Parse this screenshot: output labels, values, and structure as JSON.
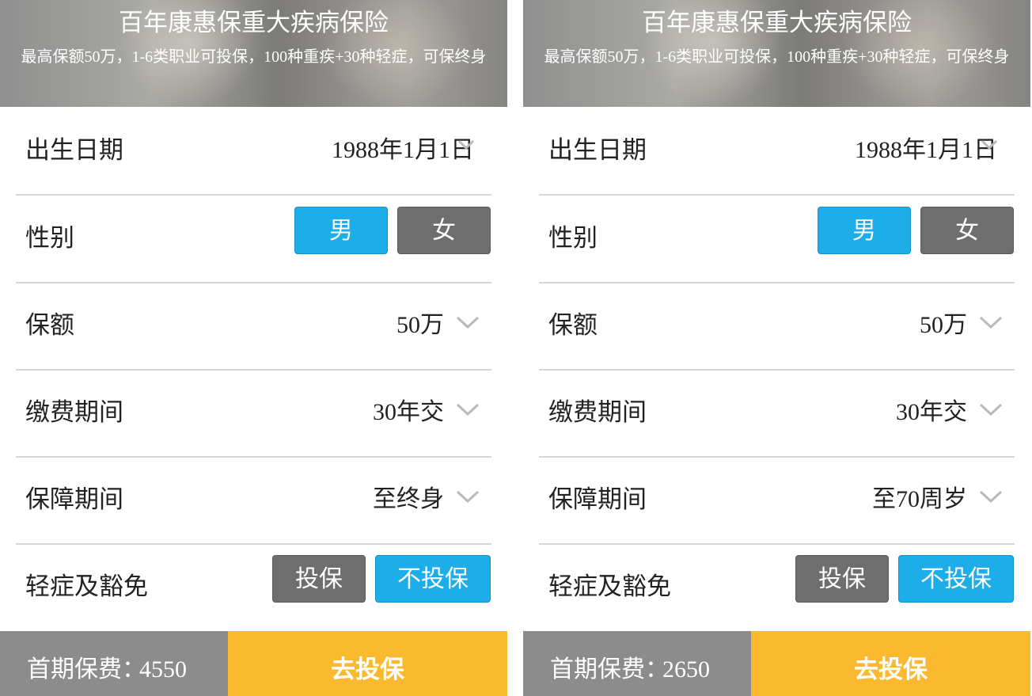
{
  "panels": [
    {
      "header": {
        "title": "百年康惠保重大疾病保险",
        "subtitle": "最高保额50万，1-6类职业可投保，100种重疾+30种轻症，可保终身"
      },
      "birth_date": {
        "label": "出生日期",
        "value": "1988年1月1日"
      },
      "gender": {
        "label": "性别",
        "male": "男",
        "female": "女",
        "selected": "男"
      },
      "coverage": {
        "label": "保额",
        "value": "50万"
      },
      "payment_period": {
        "label": "缴费期间",
        "value": "30年交"
      },
      "protection_period": {
        "label": "保障期间",
        "value": "至终身"
      },
      "mild_waiver": {
        "label": "轻症及豁免",
        "insure": "投保",
        "not_insure": "不投保",
        "selected": "不投保"
      },
      "footer": {
        "premium_label": "首期保费：",
        "premium_value": "4550",
        "cta": "去投保"
      }
    },
    {
      "header": {
        "title": "百年康惠保重大疾病保险",
        "subtitle": "最高保额50万，1-6类职业可投保，100种重疾+30种轻症，可保终身"
      },
      "birth_date": {
        "label": "出生日期",
        "value": "1988年1月1日"
      },
      "gender": {
        "label": "性别",
        "male": "男",
        "female": "女",
        "selected": "男"
      },
      "coverage": {
        "label": "保额",
        "value": "50万"
      },
      "payment_period": {
        "label": "缴费期间",
        "value": "30年交"
      },
      "protection_period": {
        "label": "保障期间",
        "value": "至70周岁"
      },
      "mild_waiver": {
        "label": "轻症及豁免",
        "insure": "投保",
        "not_insure": "不投保",
        "selected": "不投保"
      },
      "footer": {
        "premium_label": "首期保费：",
        "premium_value": "2650",
        "cta": "去投保"
      }
    }
  ],
  "colors": {
    "selected_button": "#1daee9",
    "unselected_button": "#6e6e6e",
    "cta": "#fbb930",
    "premium_bar": "#8c8c8c",
    "divider": "#d6d6d6"
  },
  "icons": {
    "dropdown": "chevron-down-icon"
  }
}
